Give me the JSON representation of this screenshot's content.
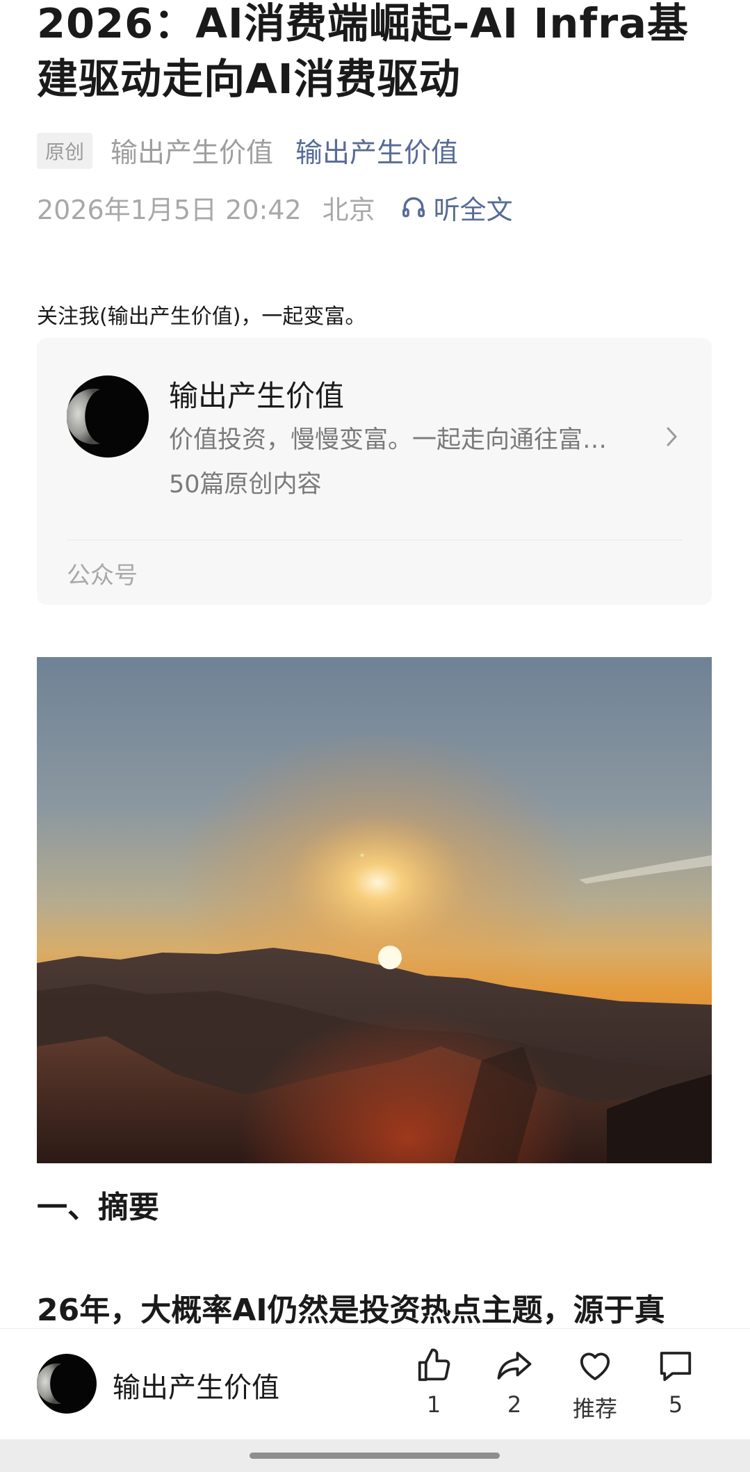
{
  "article": {
    "title": "2026：AI消费端崛起-AI Infra基建驱动走向AI消费驱动",
    "original_badge": "原创",
    "author": "输出产生价值",
    "account_link": "输出产生价值",
    "datetime": "2026年1月5日 20:42",
    "location": "北京",
    "listen_label": "听全文",
    "follow_text": "关注我(输出产生价值)，一起变富。",
    "section_heading": "一、摘要",
    "paragraph_start": "26年，大概率AI仍然是投资热点主题，源于真"
  },
  "account_card": {
    "name": "输出产生价值",
    "description": "价值投资，慢慢变富。一起走向通往富…",
    "post_count": "50篇原创内容",
    "type_label": "公众号"
  },
  "bottom_bar": {
    "name": "输出产生价值",
    "like_count": "1",
    "share_count": "2",
    "recommend_label": "推荐",
    "comment_count": "5"
  },
  "colors": {
    "link": "#576b95",
    "meta_gray": "#a8a8a8",
    "text": "#1a1a1a",
    "card_bg": "#f7f7f7"
  }
}
